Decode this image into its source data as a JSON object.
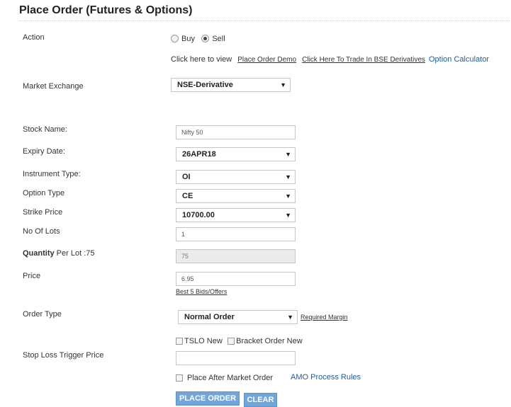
{
  "page": {
    "title": "Place Order (Futures & Options)"
  },
  "action": {
    "label": "Action",
    "options": [
      {
        "label": "Buy",
        "selected": false
      },
      {
        "label": "Sell",
        "selected": true
      }
    ]
  },
  "links": {
    "prefix": "Click here to view",
    "place_order_demo": "Place Order Demo",
    "bse_derivatives": "Click Here To Trade In BSE Derivatives",
    "option_calculator": "Option Calculator"
  },
  "market_exchange": {
    "label": "Market Exchange",
    "value": "NSE-Derivative"
  },
  "form": {
    "stock_name": {
      "label": "Stock Name:",
      "value": "Nifty 50"
    },
    "expiry_date": {
      "label": "Expiry Date:",
      "value": "26APR18"
    },
    "instrument_type": {
      "label": "Instrument Type:",
      "value": "OI"
    },
    "option_type": {
      "label": "Option Type",
      "value": "CE"
    },
    "strike_price": {
      "label": "Strike Price",
      "value": "10700.00"
    },
    "no_of_lots": {
      "label": "No Of Lots",
      "value": "1"
    },
    "quantity_per_lot": {
      "label_bold": "Quantity",
      "label_rest": " Per Lot :75",
      "value": "75"
    },
    "price": {
      "label": "Price",
      "value": "6.95",
      "link": "Best 5 Bids/Offers"
    },
    "order_type": {
      "label": "Order Type",
      "value": "Normal Order",
      "link": "Required Margin"
    },
    "tslo": {
      "label": "TSLO New",
      "checked": false
    },
    "bracket_order": {
      "label": "Bracket Order New",
      "checked": false
    },
    "stop_loss": {
      "label": "Stop Loss Trigger Price",
      "value": ""
    },
    "after_market": {
      "label": "Place After Market Order",
      "checked": false
    },
    "amo_rules": "AMO Process Rules"
  },
  "buttons": {
    "place_order": "PLACE ORDER",
    "clear": "CLEAR"
  },
  "colors": {
    "button_bg": "#73a6d8",
    "link_blue": "#1f5a9c"
  },
  "icons": {
    "select_arrow": "dropdown-arrow-icon"
  }
}
